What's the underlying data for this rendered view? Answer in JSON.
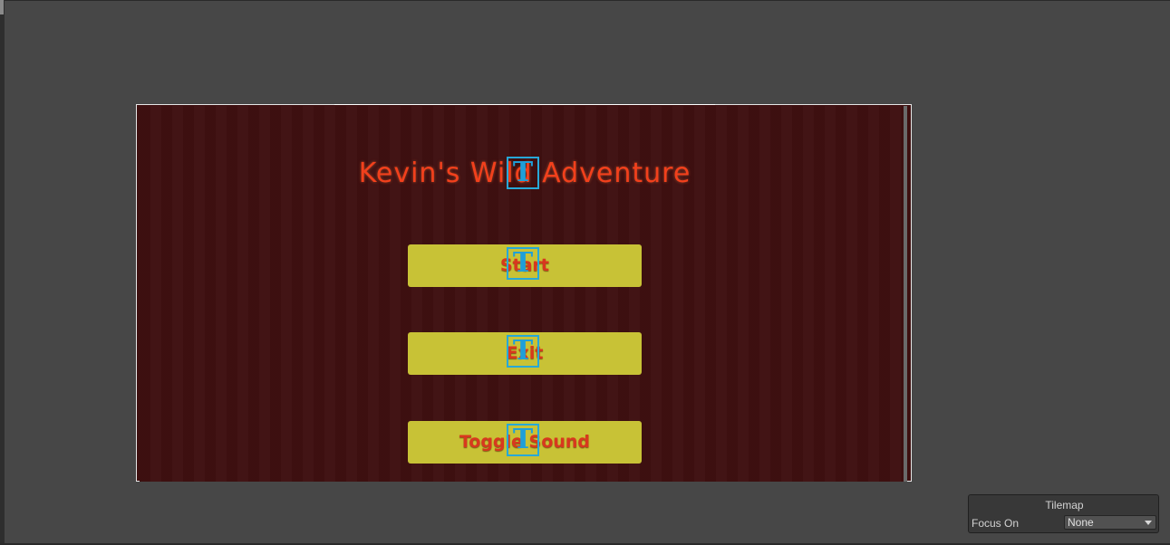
{
  "game": {
    "title": "Kevin's Wild Adventure"
  },
  "menu": {
    "buttons": [
      {
        "label": "Start"
      },
      {
        "label": "Exit"
      },
      {
        "label": "Toggle Sound"
      }
    ]
  },
  "gizmo": {
    "text_icon_glyph": "T"
  },
  "tilemap_overlay": {
    "title": "Tilemap",
    "focus_label": "Focus On",
    "focus_value": "None"
  },
  "colors": {
    "canvas_background": "#3f1011",
    "button_fill": "#c8c236",
    "button_text": "#d8381e",
    "title_text": "#f2401c",
    "gizmo_blue": "#27a8d8",
    "editor_background": "#474747"
  }
}
